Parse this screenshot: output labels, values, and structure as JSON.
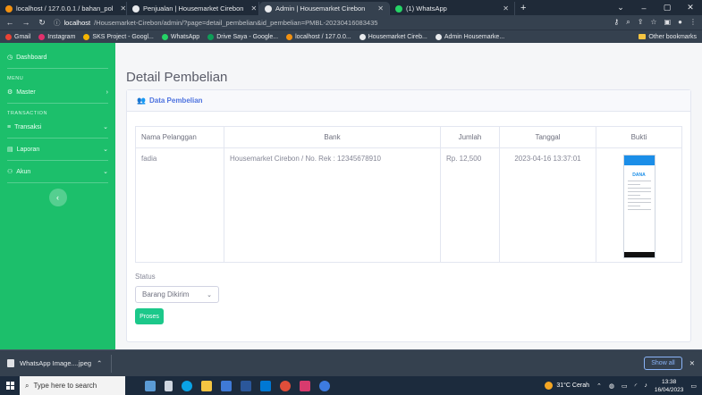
{
  "browser": {
    "tabs": [
      {
        "title": "localhost / 127.0.0.1 / bahan_pol",
        "color": "#f29111"
      },
      {
        "title": "Penjualan | Housemarket Cirebon",
        "color": "#e8eaed"
      },
      {
        "title": "Admin | Housemarket Cirebon",
        "color": "#e8eaed",
        "active": true
      },
      {
        "title": "(1) WhatsApp",
        "color": "#25d366"
      }
    ],
    "url_host": "localhost",
    "url_path": "/Housemarket-Cirebon/admin/?page=detail_pembelian&id_pembelian=PMBL-20230416083435",
    "bookmarks": [
      {
        "label": "Gmail",
        "color": "#ea4335"
      },
      {
        "label": "Instagram",
        "color": "#e1306c"
      },
      {
        "label": "SKS Project - Googl...",
        "color": "#f4b400"
      },
      {
        "label": "WhatsApp",
        "color": "#25d366"
      },
      {
        "label": "Drive Saya - Google...",
        "color": "#0f9d58"
      },
      {
        "label": "localhost / 127.0.0...",
        "color": "#f29111"
      },
      {
        "label": "Housemarket Cireb...",
        "color": "#e8eaed"
      },
      {
        "label": "Admin Housemarke...",
        "color": "#e8eaed"
      }
    ],
    "other_bookmarks": "Other bookmarks"
  },
  "sidebar": {
    "dashboard": "Dashboard",
    "menu_heading": "MENU",
    "master": "Master",
    "transaction_heading": "TRANSACTION",
    "transaksi": "Transaksi",
    "laporan": "Laporan",
    "akun": "Akun"
  },
  "main": {
    "page_title": "Detail Pembelian",
    "card_title": "Data Pembelian",
    "table": {
      "headers": [
        "Nama Pelanggan",
        "Bank",
        "Jumlah",
        "Tanggal",
        "Bukti"
      ],
      "row": {
        "nama": "fadia",
        "bank": "Housemarket Cirebon / No. Rek : 12345678910",
        "jumlah": "Rp. 12,500",
        "tanggal": "2023-04-16 13:37:01"
      },
      "receipt_brand": "DANA"
    },
    "status_label": "Status",
    "status_value": "Barang Dikirim",
    "proses_button": "Proses"
  },
  "downloads": {
    "file": "WhatsApp Image....jpeg",
    "show_all": "Show all"
  },
  "taskbar": {
    "search_placeholder": "Type here to search",
    "weather": "31°C  Cerah",
    "time": "13:38",
    "date": "16/04/2023"
  }
}
